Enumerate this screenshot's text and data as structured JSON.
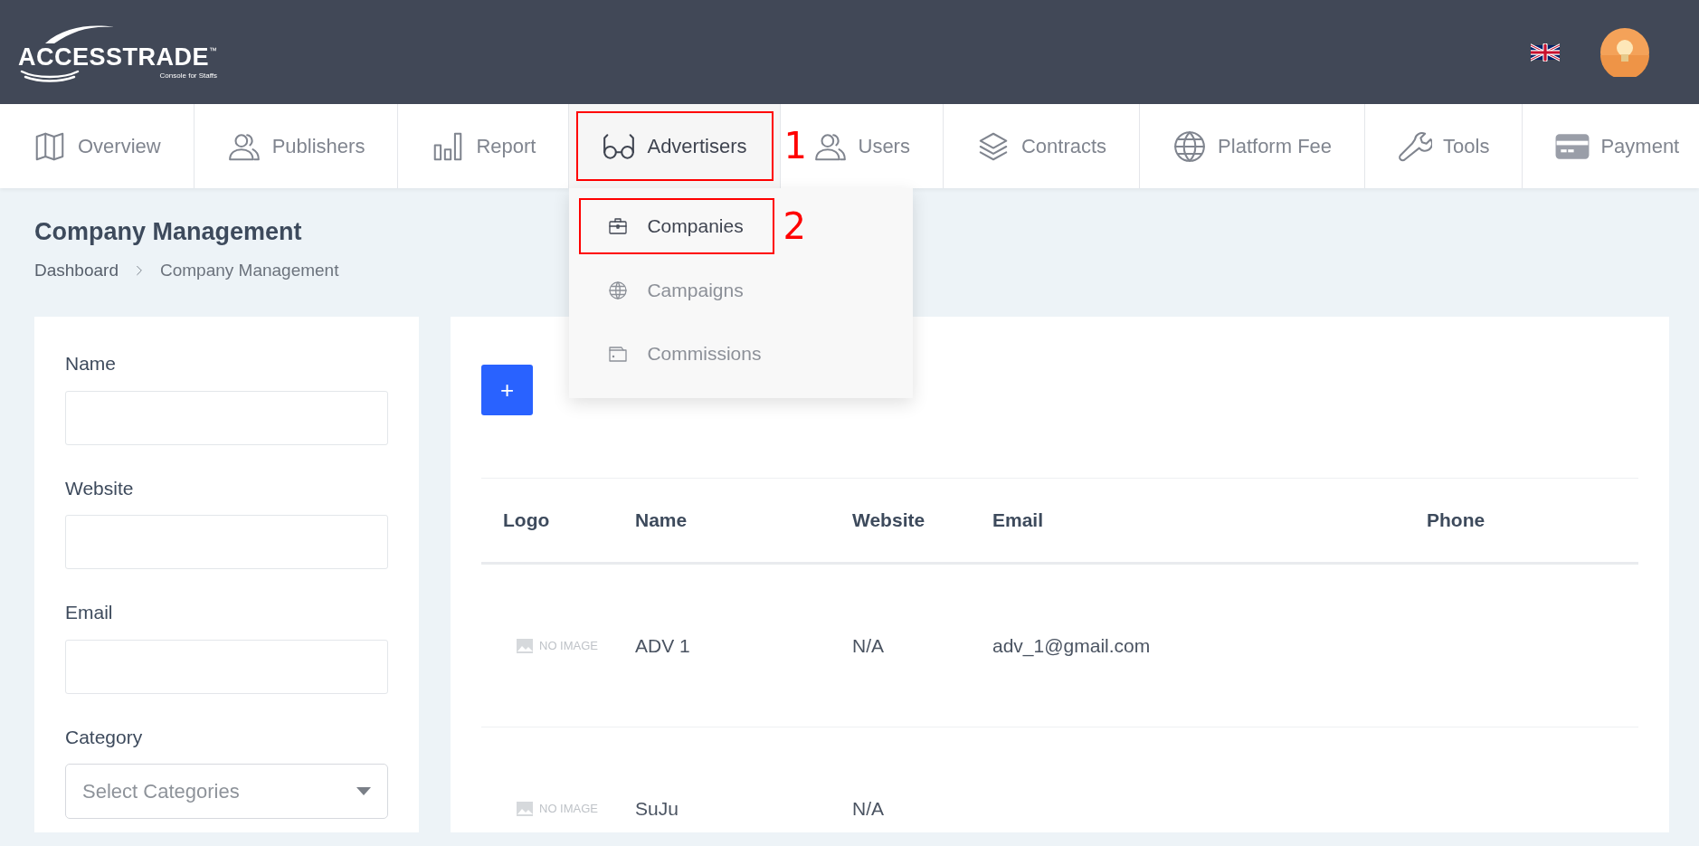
{
  "header": {
    "logo": {
      "name": "ACCESSTRADE",
      "trademark": "™",
      "tagline": "Console for Staffs"
    }
  },
  "nav": [
    {
      "label": "Overview",
      "selected": false
    },
    {
      "label": "Publishers",
      "selected": false
    },
    {
      "label": "Report",
      "selected": false
    },
    {
      "label": "Advertisers",
      "selected": true,
      "callout": "1",
      "dropdown": [
        {
          "label": "Companies",
          "selected": true,
          "callout": "2"
        },
        {
          "label": "Campaigns",
          "selected": false
        },
        {
          "label": "Commissions",
          "selected": false
        }
      ]
    },
    {
      "label": "Users",
      "selected": false
    },
    {
      "label": "Contracts",
      "selected": false
    },
    {
      "label": "Platform Fee",
      "selected": false
    },
    {
      "label": "Tools",
      "selected": false
    },
    {
      "label": "Payment",
      "selected": false
    }
  ],
  "page": {
    "title": "Company Management",
    "breadcrumb": [
      "Dashboard",
      "Company Management"
    ]
  },
  "filters": [
    {
      "label": "Name",
      "kind": "text"
    },
    {
      "label": "Website",
      "kind": "text"
    },
    {
      "label": "Email",
      "kind": "text"
    },
    {
      "label": "Category",
      "kind": "select",
      "placeholder": "Select Categories"
    }
  ],
  "add_button": "+",
  "table": {
    "columns": [
      "Logo",
      "Name",
      "Website",
      "Email",
      "Phone"
    ],
    "rows": [
      {
        "logo": "NO IMAGE",
        "name": "ADV 1",
        "website": "N/A",
        "email": "adv_1@gmail.com"
      },
      {
        "logo": "NO IMAGE",
        "name": "SuJu",
        "website": "N/A"
      }
    ]
  }
}
